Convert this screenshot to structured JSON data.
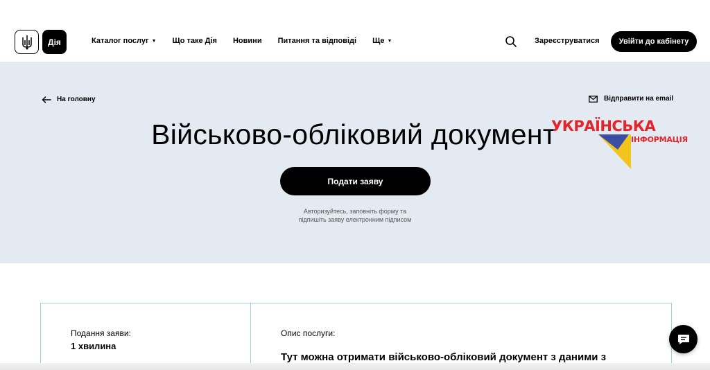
{
  "header": {
    "logo_text": "Дія",
    "nav": [
      {
        "label": "Каталог послуг",
        "has_dropdown": true
      },
      {
        "label": "Що таке Дія",
        "has_dropdown": false
      },
      {
        "label": "Новини",
        "has_dropdown": false
      },
      {
        "label": "Питання та відповіді",
        "has_dropdown": false
      },
      {
        "label": "Ще",
        "has_dropdown": true
      }
    ],
    "search_icon": "search-icon",
    "register_label": "Зареєструватися",
    "login_label": "Увійти до кабінету"
  },
  "hero": {
    "back_label": "На головну",
    "email_label": "Відправити на email",
    "title": "Військово-обліковий документ",
    "apply_label": "Подати заяву",
    "hint_line1": "Авторизуйтесь, заповніть форму та",
    "hint_line2": "підпишіть заяву електронним підписом"
  },
  "watermark": {
    "line1": "УКРАЇНСЬКА",
    "line2": "ІНФОРМАЦІЯ",
    "colors": {
      "red": "#e4242b",
      "blue": "#3b4ea3",
      "yellow": "#f3c41c"
    }
  },
  "details": {
    "time_label": "Подання заяви:",
    "time_value": "1 хвилина",
    "desc_label": "Опис послуги:",
    "desc_text": "Тут можна отримати військово-обліковий документ з даними з"
  },
  "colors": {
    "hero_bg": "#e3eaf1",
    "accent": "#000000",
    "panel_border": "#9fd6d3"
  }
}
